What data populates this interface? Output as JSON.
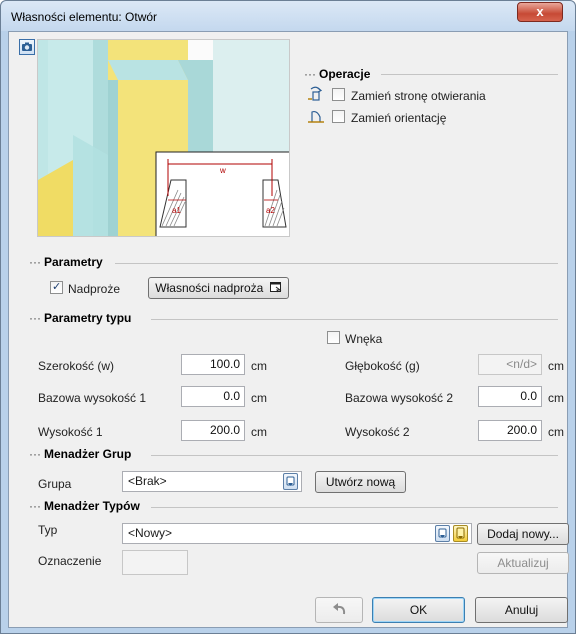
{
  "window": {
    "title": "Własności elementu: Otwór",
    "close_symbol": "x"
  },
  "preview": {
    "dimension_width_label": "w",
    "dimension_a1_label": "a1",
    "dimension_a2_label": "a2",
    "colors": {
      "wall": "#a9d8d8",
      "floor": "#f3e37a",
      "hatch": "#8c8c8c",
      "dim": "#b00000"
    }
  },
  "operacje": {
    "header": "Operacje",
    "swap_opening_side": {
      "label": "Zamień stronę otwierania",
      "checked": false
    },
    "swap_orientation": {
      "label": "Zamień orientację",
      "checked": false
    }
  },
  "parametry": {
    "header": "Parametry",
    "nadproze": {
      "label": "Nadproże",
      "checked": true
    },
    "lintel_properties_button": "Własności nadproża"
  },
  "parametry_typu": {
    "header": "Parametry typu",
    "wneka": {
      "label": "Wnęka",
      "checked": false
    },
    "szerokosc": {
      "label": "Szerokość (w)",
      "value": "100.0",
      "unit": "cm"
    },
    "glebokosc": {
      "label": "Głębokość (g)",
      "value": "<n/d>",
      "unit": "cm"
    },
    "bazowa_wysokosc_1": {
      "label": "Bazowa wysokość 1",
      "value": "0.0",
      "unit": "cm"
    },
    "bazowa_wysokosc_2": {
      "label": "Bazowa wysokość 2",
      "value": "0.0",
      "unit": "cm"
    },
    "wysokosc_1": {
      "label": "Wysokość 1",
      "value": "200.0",
      "unit": "cm"
    },
    "wysokosc_2": {
      "label": "Wysokość 2",
      "value": "200.0",
      "unit": "cm"
    }
  },
  "menadzer_grup": {
    "header": "Menadżer Grup",
    "grupa_label": "Grupa",
    "grupa_value": "<Brak>",
    "create_new_button": "Utwórz nową"
  },
  "menadzer_typow": {
    "header": "Menadżer Typów",
    "typ_label": "Typ",
    "typ_value": "<Nowy>",
    "add_new_button": "Dodaj nowy...",
    "oznaczenie_label": "Oznaczenie",
    "oznaczenie_value": "",
    "update_button": "Aktualizuj"
  },
  "footer": {
    "ok_button": "OK",
    "cancel_button": "Anuluj"
  }
}
